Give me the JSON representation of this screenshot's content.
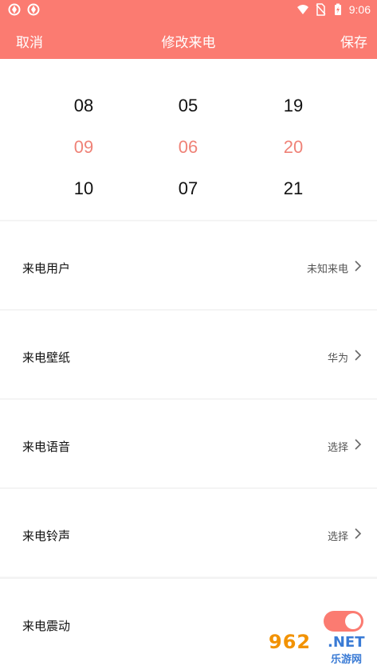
{
  "status_bar": {
    "time": "9:06"
  },
  "header": {
    "cancel_label": "取消",
    "title": "修改来电",
    "save_label": "保存"
  },
  "time_picker": {
    "hour": {
      "prev": "08",
      "selected": "09",
      "next": "10"
    },
    "minute": {
      "prev": "05",
      "selected": "06",
      "next": "07"
    },
    "second": {
      "prev": "19",
      "selected": "20",
      "next": "21"
    },
    "selected_color": "#ef8277"
  },
  "settings": {
    "caller": {
      "label": "来电用户",
      "value": "未知来电"
    },
    "wallpaper": {
      "label": "来电壁纸",
      "value": "华为"
    },
    "voice": {
      "label": "来电语音",
      "value": "选择"
    },
    "ringtone": {
      "label": "来电铃声",
      "value": "选择"
    },
    "vibration": {
      "label": "来电震动",
      "enabled": true
    }
  },
  "watermark": {
    "brand": "962",
    "suffix": ".NET",
    "site": "乐游网"
  },
  "colors": {
    "accent": "#fb7b71"
  }
}
